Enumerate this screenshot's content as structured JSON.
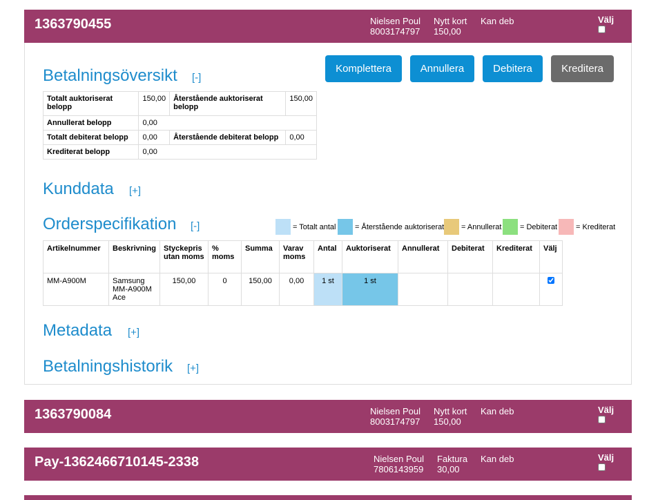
{
  "orders": [
    {
      "id": "1363790455",
      "customer_name": "Nielsen Poul",
      "customer_number": "8003174797",
      "payment_type": "Nytt kort",
      "amount": "150,00",
      "status": "Kan deb",
      "select_label": "Välj"
    },
    {
      "id": "1363790084",
      "customer_name": "Nielsen Poul",
      "customer_number": "8003174797",
      "payment_type": "Nytt kort",
      "amount": "150,00",
      "status": "Kan deb",
      "select_label": "Välj"
    },
    {
      "id": "Pay-1362466710145-2338",
      "customer_name": "Nielsen Poul",
      "customer_number": "7806143959",
      "payment_type": "Faktura",
      "amount": "30,00",
      "status": "Kan deb",
      "select_label": "Välj"
    }
  ],
  "actions": {
    "complete": "Komplettera",
    "cancel": "Annullera",
    "debit": "Debitera",
    "credit": "Kreditera"
  },
  "sections": {
    "payment_overview": {
      "title": "Betalningsöversikt",
      "toggle": "[-]"
    },
    "customer_data": {
      "title": "Kunddata",
      "toggle": "[+]"
    },
    "order_spec": {
      "title": "Orderspecifikation",
      "toggle": "[-]"
    },
    "metadata": {
      "title": "Metadata",
      "toggle": "[+]"
    },
    "payment_history": {
      "title": "Betalningshistorik",
      "toggle": "[+]"
    }
  },
  "payment_overview": {
    "total_authorized_label": "Totalt auktoriserat belopp",
    "total_authorized": "150,00",
    "remaining_authorized_label": "Återstående auktoriserat belopp",
    "remaining_authorized": "150,00",
    "cancelled_label": "Annullerat belopp",
    "cancelled": "0,00",
    "total_debited_label": "Totalt debiterat belopp",
    "total_debited": "0,00",
    "remaining_debited_label": "Återstående debiterat belopp",
    "remaining_debited": "0,00",
    "credited_label": "Krediterat belopp",
    "credited": "0,00"
  },
  "legend": [
    {
      "color": "#bde0f7",
      "label": "= Totalt antal"
    },
    {
      "color": "#76c6e8",
      "label": "= Återstående auktoriserat"
    },
    {
      "color": "#e8c97a",
      "label": "= Annullerat"
    },
    {
      "color": "#8ce07f",
      "label": "= Debiterat"
    },
    {
      "color": "#f7b8b8",
      "label": "= Krediterat"
    }
  ],
  "order_table": {
    "headers": [
      "Artikelnummer",
      "Beskrivning",
      "Styckepris utan moms",
      "% moms",
      "Summa",
      "Varav moms",
      "Antal",
      "Auktoriserat",
      "Annullerat",
      "Debiterat",
      "Krediterat",
      "Välj"
    ],
    "row": {
      "article": "MM-A900M",
      "description": "Samsung MM-A900M Ace",
      "unit_price": "150,00",
      "vat_pct": "0",
      "sum": "150,00",
      "vat": "0,00",
      "qty": "1 st",
      "authorized": "1 st",
      "cancelled": "",
      "debited": "",
      "credited": "",
      "selected": true
    }
  },
  "colors": {
    "header_bg": "#9b3b6a",
    "accent": "#1e8ccc",
    "button": "#0d8fd3",
    "button_grey": "#6b6b6b"
  }
}
